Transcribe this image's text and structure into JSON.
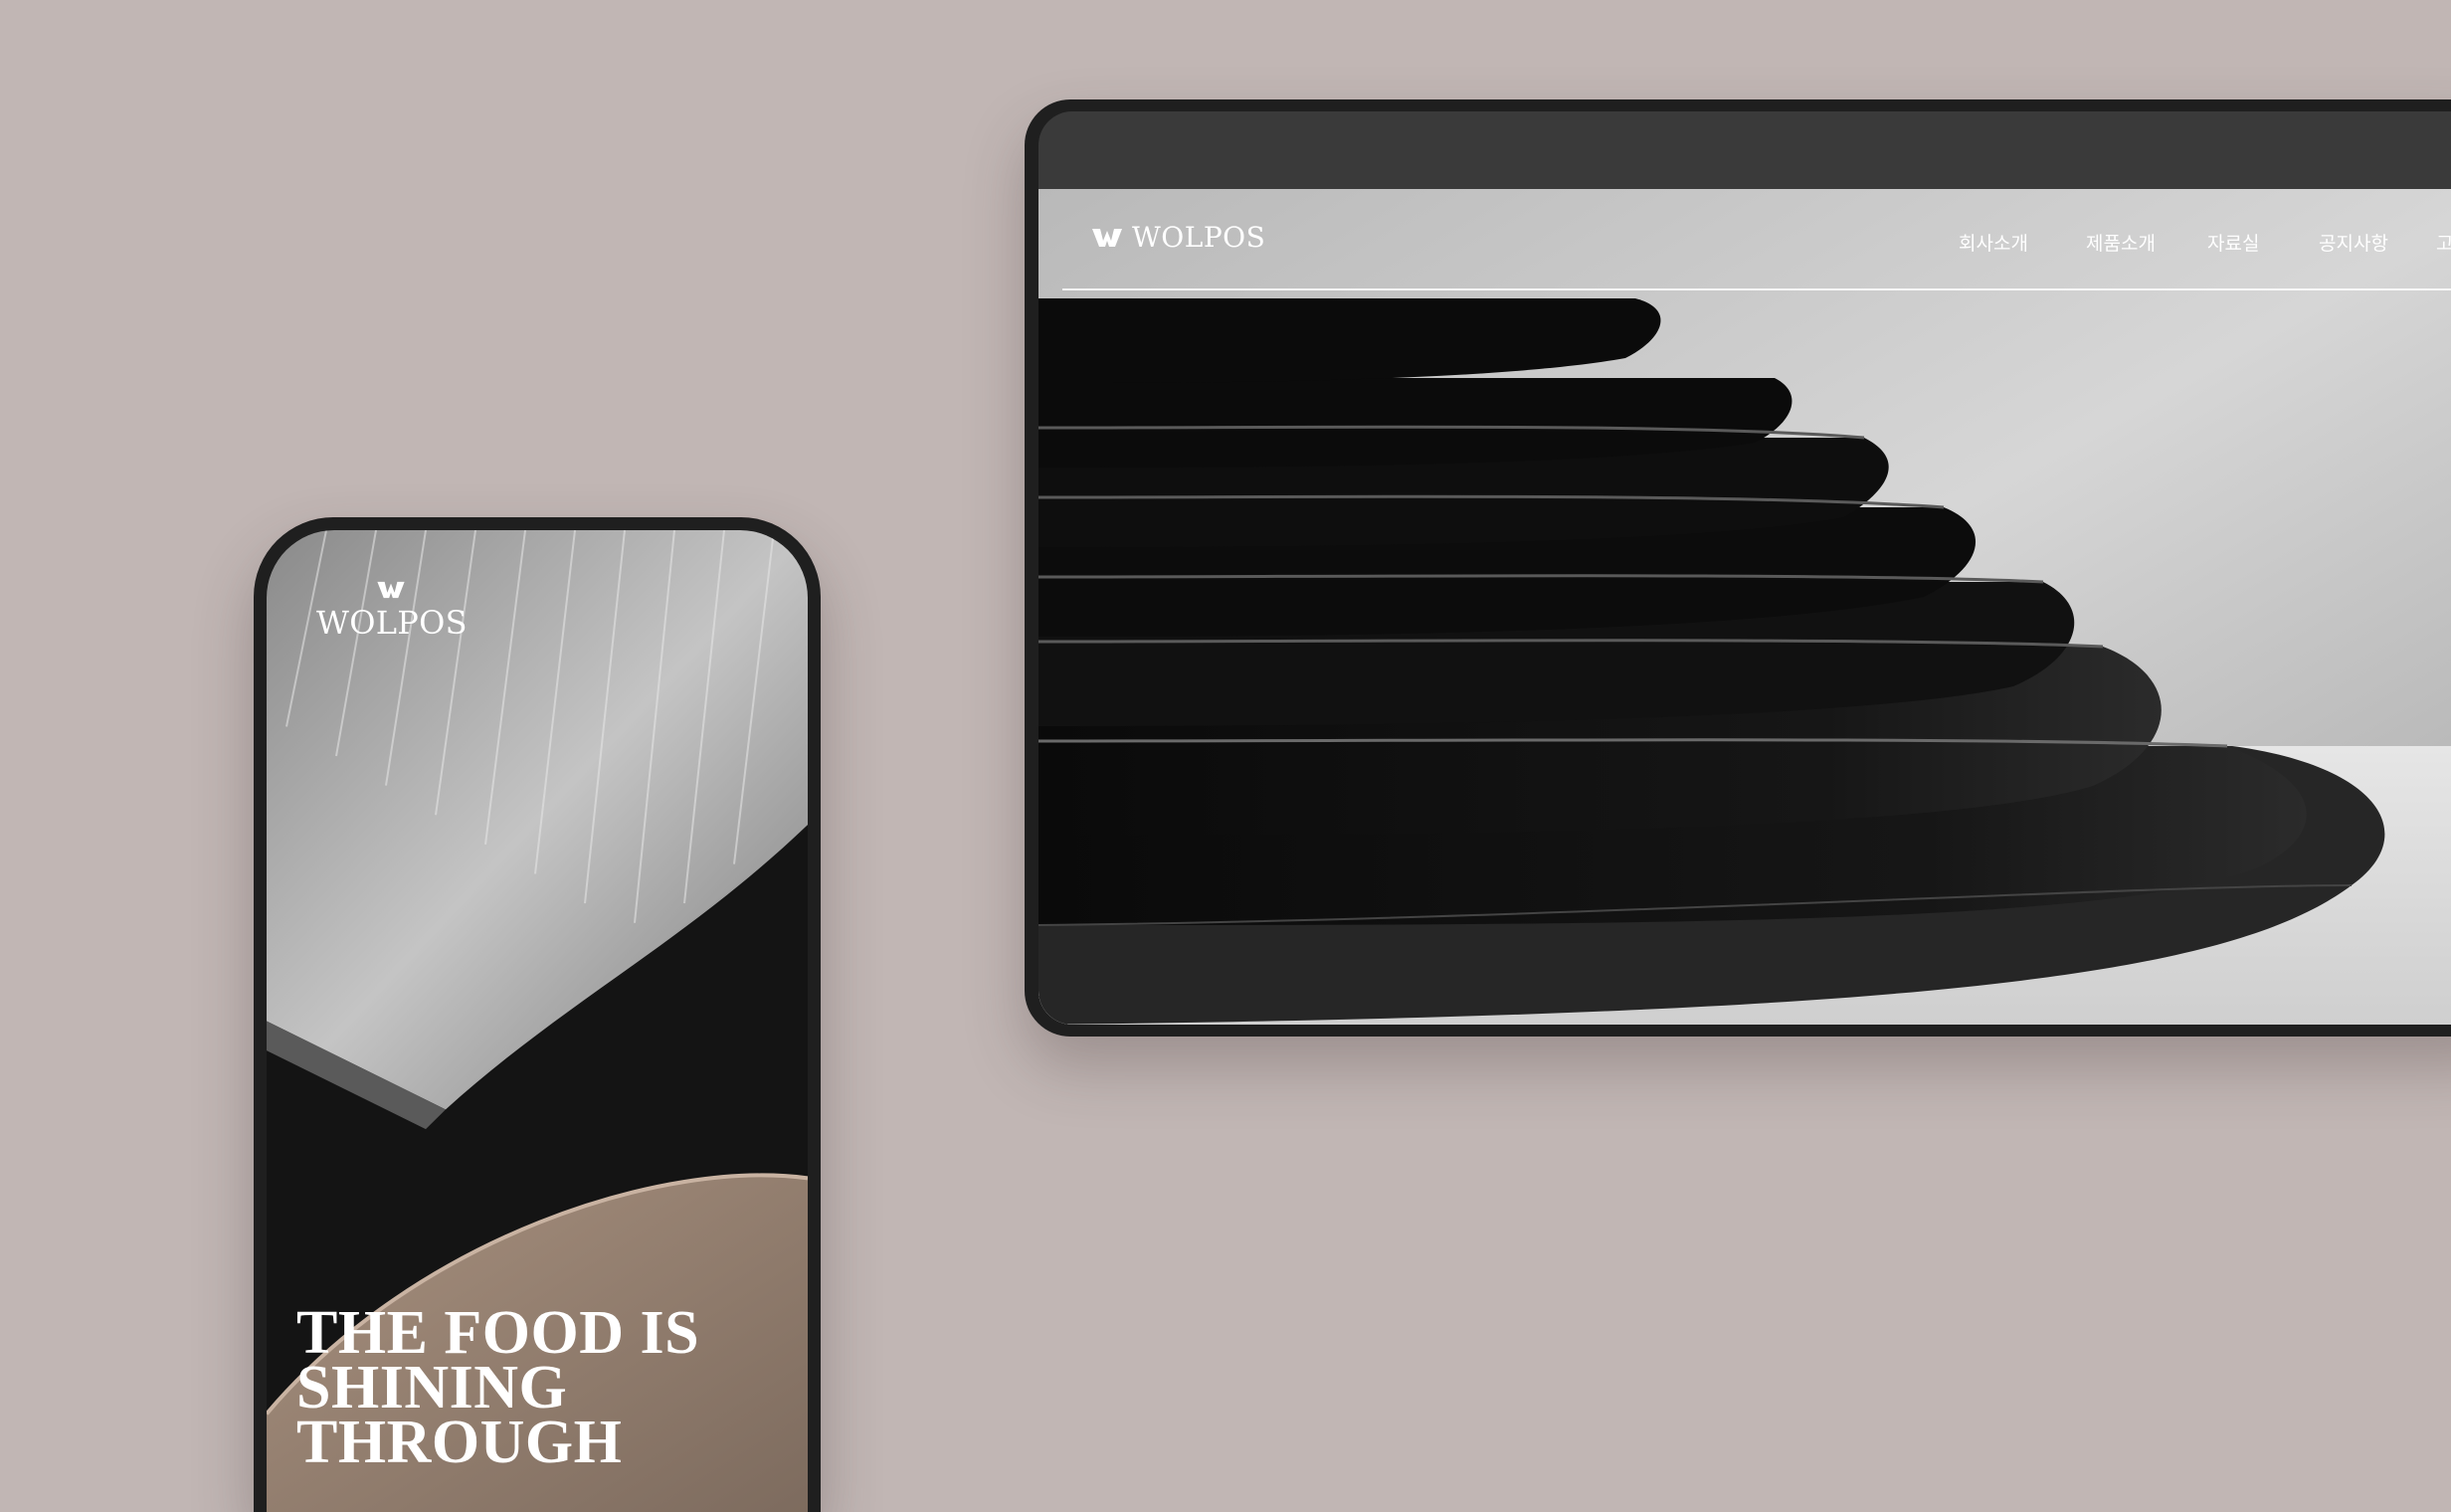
{
  "desktop": {
    "logo_text": "WOLPOS",
    "nav": [
      {
        "label": "회사소개"
      },
      {
        "label": "제품소개"
      },
      {
        "label": "자료실"
      },
      {
        "label": "공지사항"
      },
      {
        "label": "고"
      }
    ]
  },
  "mobile": {
    "logo_text": "WOLPOS",
    "headline_lines": [
      "THE FOOD IS",
      "SHINING",
      "THROUGH"
    ]
  },
  "colors": {
    "background": "#c1b6b4",
    "device_frame": "#1f1f1f",
    "text": "#ffffff"
  },
  "icons": {
    "brand_mark": "w-logo-icon"
  }
}
